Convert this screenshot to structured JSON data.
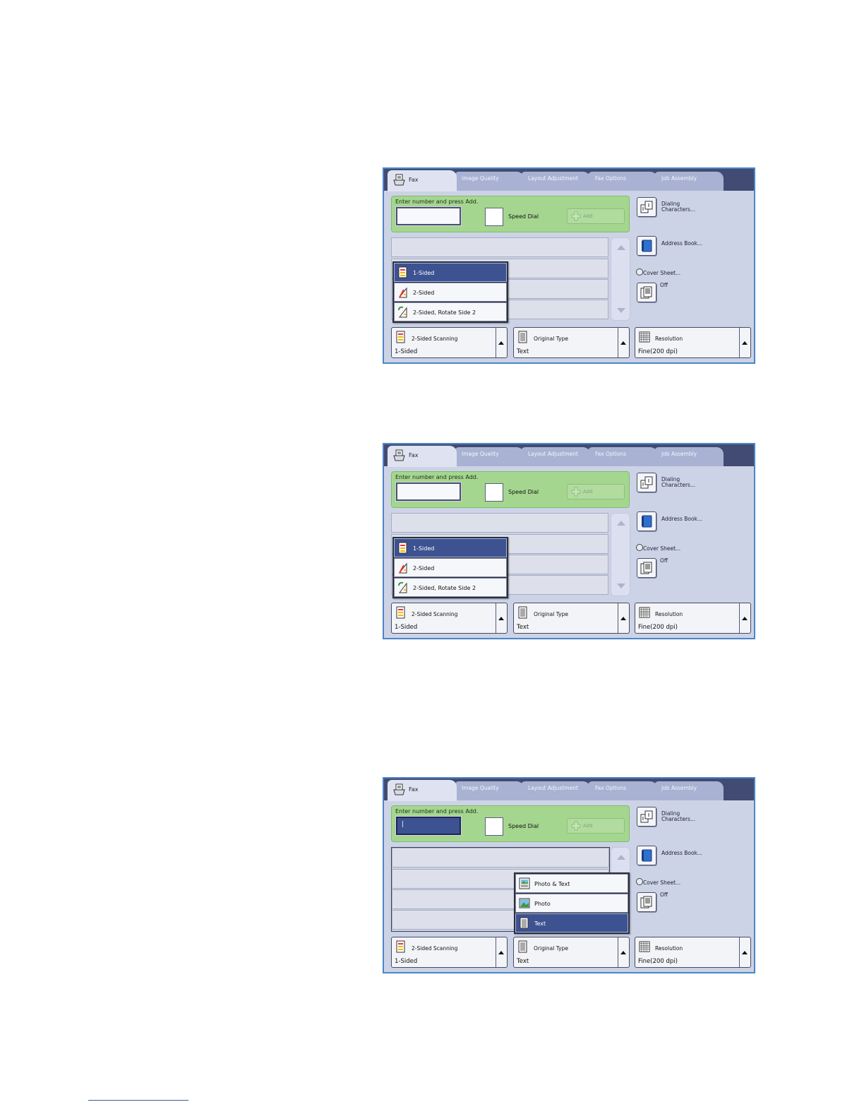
{
  "screens": [
    {
      "tabs": [
        "Fax",
        "Image Quality",
        "Layout Adjustment",
        "Fax Options",
        "Job Assembly"
      ],
      "entry_label": "Enter number and press Add.",
      "number_input_value": "",
      "speed_dial_label": "Speed Dial",
      "add_label": "Add",
      "dialing_label": "Dialing Characters...",
      "address_label": "Address Book...",
      "cover_label": "Cover Sheet...",
      "cover_value": "Off",
      "popup_options": [
        "1-Sided",
        "2-Sided",
        "2-Sided, Rotate Side 2"
      ],
      "popup_selected": "1-Sided",
      "scanning_title": "2-Sided Scanning",
      "scanning_value": "1-Sided",
      "original_title": "Original Type",
      "original_value": "Text",
      "resolution_title": "Resolution",
      "resolution_value": "Fine(200 dpi)"
    },
    {
      "tabs": [
        "Fax",
        "Image Quality",
        "Layout Adjustment",
        "Fax Options",
        "Job Assembly"
      ],
      "entry_label": "Enter number and press Add.",
      "number_input_value": "",
      "speed_dial_label": "Speed Dial",
      "add_label": "Add",
      "dialing_label": "Dialing Characters...",
      "address_label": "Address Book...",
      "cover_label": "Cover Sheet...",
      "cover_value": "Off",
      "popup_options": [
        "1-Sided",
        "2-Sided",
        "2-Sided, Rotate Side 2"
      ],
      "popup_selected": "1-Sided",
      "scanning_title": "2-Sided Scanning",
      "scanning_value": "1-Sided",
      "original_title": "Original Type",
      "original_value": "Text",
      "resolution_title": "Resolution",
      "resolution_value": "Fine(200 dpi)"
    },
    {
      "tabs": [
        "Fax",
        "Image Quality",
        "Layout Adjustment",
        "Fax Options",
        "Job Assembly"
      ],
      "entry_label": "Enter number and press Add.",
      "number_input_value": "|",
      "speed_dial_label": "Speed Dial",
      "add_label": "Add",
      "dialing_label": "Dialing Characters...",
      "address_label": "Address Book...",
      "cover_label": "Cover Sheet...",
      "cover_value": "Off",
      "popup_options": [
        "Photo & Text",
        "Photo",
        "Text"
      ],
      "popup_selected": "Text",
      "scanning_title": "2-Sided Scanning",
      "scanning_value": "1-Sided",
      "original_title": "Original Type",
      "original_value": "Text",
      "resolution_title": "Resolution",
      "resolution_value": "Fine(200 dpi)"
    }
  ],
  "colors": {
    "accent_selected": "#3d5291",
    "entry_green": "#a5d690",
    "tab_bar": "#414b73",
    "screen_border": "#4a86c8"
  },
  "icons": {
    "fax_tab": "fax-icon",
    "dialing": "dialing-characters-icon",
    "address_book": "address-book-icon",
    "cover_sheet": "cover-sheet-icon",
    "add": "plus-icon",
    "one_sided": "one-sided-icon",
    "two_sided": "two-sided-icon",
    "two_sided_rotate": "two-sided-rotate-icon",
    "photo_text": "photo-text-icon",
    "photo": "photo-icon",
    "text": "text-document-icon",
    "resolution": "resolution-grid-icon"
  }
}
